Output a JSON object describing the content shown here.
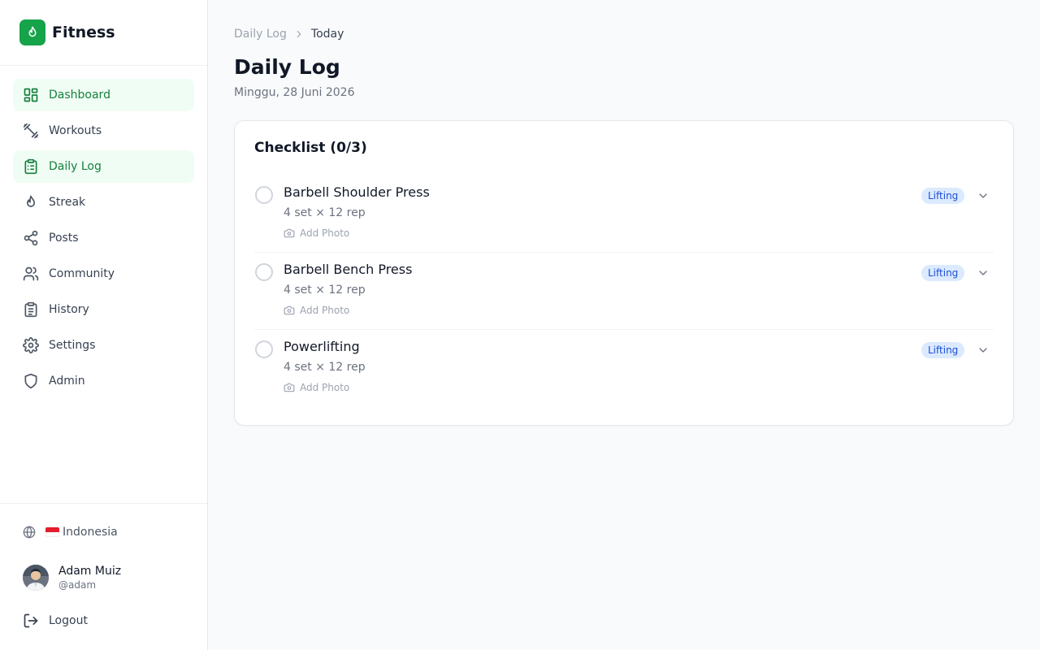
{
  "app": {
    "name": "Fitness"
  },
  "sidebar": {
    "items": [
      {
        "label": "Dashboard",
        "icon": "dashboard-icon",
        "active": true
      },
      {
        "label": "Workouts",
        "icon": "dumbbell-icon",
        "active": false
      },
      {
        "label": "Daily Log",
        "icon": "clipboard-list-icon",
        "active": true
      },
      {
        "label": "Streak",
        "icon": "flame-icon",
        "active": false
      },
      {
        "label": "Posts",
        "icon": "share-icon",
        "active": false
      },
      {
        "label": "Community",
        "icon": "users-icon",
        "active": false
      },
      {
        "label": "History",
        "icon": "clipboard-icon",
        "active": false
      },
      {
        "label": "Settings",
        "icon": "gear-icon",
        "active": false
      },
      {
        "label": "Admin",
        "icon": "shield-icon",
        "active": false
      }
    ],
    "language": {
      "flag": "🇮🇩",
      "label": "Indonesia"
    },
    "user": {
      "name": "Adam Muiz",
      "handle": "@adam"
    },
    "logout_label": "Logout"
  },
  "breadcrumb": {
    "parent": "Daily Log",
    "current": "Today"
  },
  "page": {
    "title": "Daily Log",
    "date": "Minggu, 28 Juni 2026"
  },
  "checklist": {
    "title": "Checklist (0/3)",
    "add_photo_label": "Add Photo",
    "items": [
      {
        "name": "Barbell Shoulder Press",
        "detail": "4 set × 12 rep",
        "category": "Lifting",
        "done": false
      },
      {
        "name": "Barbell Bench Press",
        "detail": "4 set × 12 rep",
        "category": "Lifting",
        "done": false
      },
      {
        "name": "Powerlifting",
        "detail": "4 set × 12 rep",
        "category": "Lifting",
        "done": false
      }
    ]
  },
  "colors": {
    "brand": "#16a34a",
    "active_bg": "#f0fdf4",
    "active_text": "#15803d",
    "badge_bg": "#dbeafe",
    "badge_text": "#1d4ed8"
  }
}
